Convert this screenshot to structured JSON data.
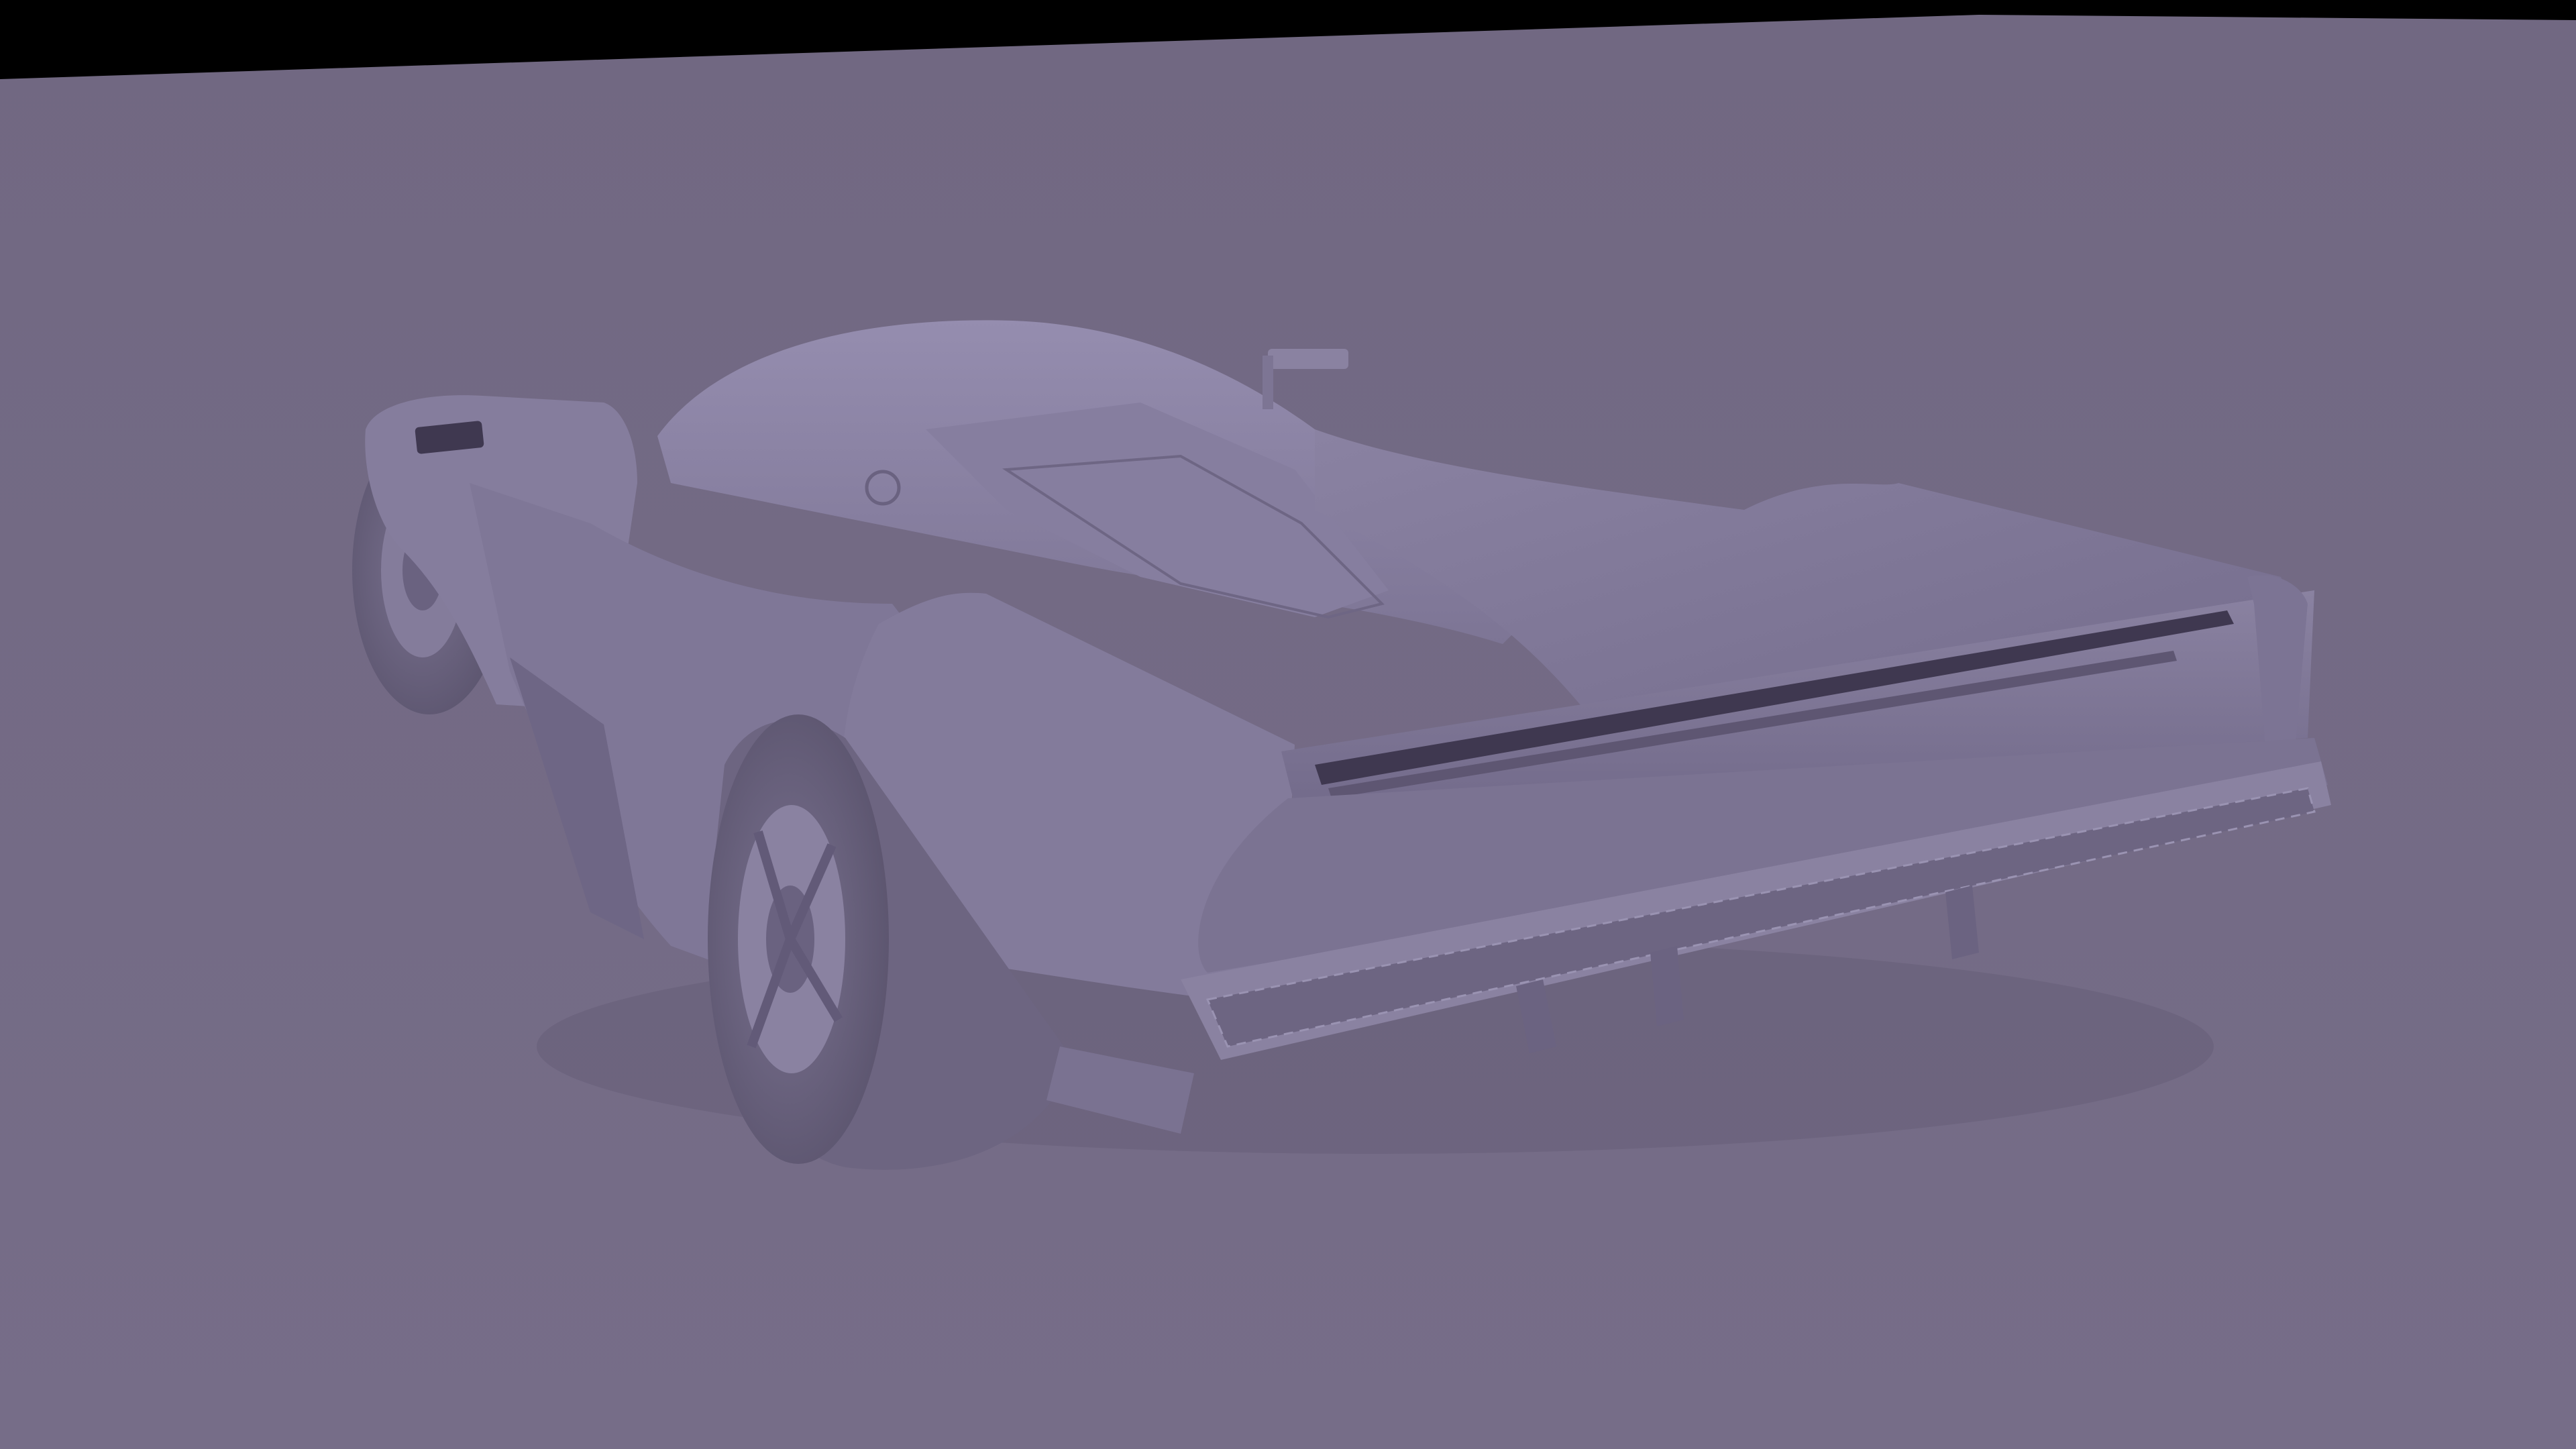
{
  "scene": {
    "colors": {
      "background": "#000000",
      "ground": "#736a85",
      "ground_far": "#716882",
      "body_light": "#8e86a6",
      "body_mid": "#7c7494",
      "body_dark": "#5e5672",
      "shadow": "#4a4358",
      "tire": "#6d6581",
      "slot": "#3f3850"
    }
  }
}
